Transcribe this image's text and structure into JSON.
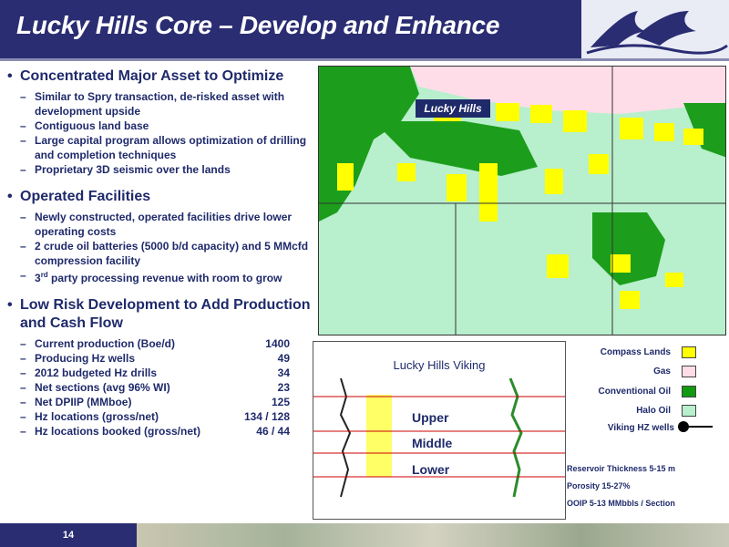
{
  "header": {
    "title": "Lucky Hills Core – Develop and Enhance"
  },
  "sections": {
    "s1": {
      "title": "Concentrated Major Asset to Optimize",
      "items": [
        "Similar to Spry transaction, de-risked asset with development upside",
        "Contiguous land base",
        "Large capital program allows optimization of drilling and completion techniques",
        "Proprietary 3D seismic over the lands"
      ]
    },
    "s2": {
      "title": "Operated Facilities",
      "items": [
        "Newly constructed, operated facilities drive lower operating costs",
        "2 crude oil batteries (5000 b/d capacity) and 5 MMcfd compression facility",
        "party processing revenue with room to grow"
      ],
      "sup_prefix": "3",
      "sup_text": "rd"
    },
    "s3": {
      "title": "Low Risk Development to Add Production and Cash Flow",
      "rows": [
        {
          "label": "Current production (Boe/d)",
          "value": "1400"
        },
        {
          "label": "Producing Hz wells",
          "value": "49"
        },
        {
          "label": "2012 budgeted Hz drills",
          "value": "34"
        },
        {
          "label": "Net sections (avg 96% WI)",
          "value": "23"
        },
        {
          "label": "Net DPIIP (MMboe)",
          "value": "125"
        },
        {
          "label": "Hz locations (gross/net)",
          "value": "134 / 128"
        },
        {
          "label": "Hz locations booked (gross/net)",
          "value": "46 / 44"
        }
      ]
    }
  },
  "map": {
    "label": "Lucky Hills"
  },
  "log": {
    "title": "Lucky Hills Viking",
    "zones": [
      "Upper",
      "Middle",
      "Lower"
    ]
  },
  "legend": {
    "items": [
      {
        "label": "Compass Lands",
        "color": "#ffff00"
      },
      {
        "label": "Gas",
        "color": "#ffdde8"
      },
      {
        "label": "Conventional Oil",
        "color": "#119911"
      },
      {
        "label": "Halo Oil",
        "color": "#b8efcc"
      },
      {
        "label": "Viking HZ wells",
        "color": "#000000"
      }
    ]
  },
  "stats": [
    "Reservoir Thickness 5-15 m",
    "Porosity 15-27%",
    "OOIP 5-13 MMbbls / Section"
  ],
  "footer": {
    "page_number": "14"
  }
}
